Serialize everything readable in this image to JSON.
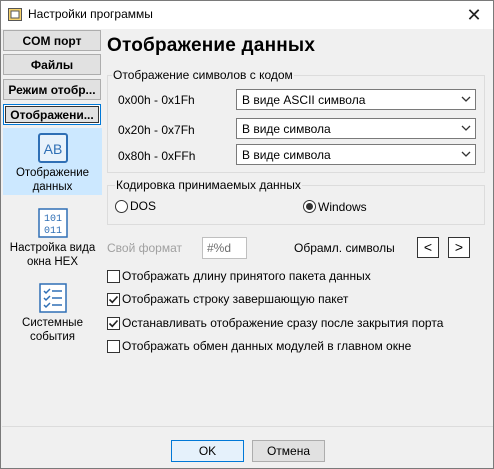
{
  "window": {
    "title": "Настройки программы",
    "close_glyph": "✕"
  },
  "nav": {
    "buttons": [
      {
        "label": "COM порт"
      },
      {
        "label": "Файлы"
      },
      {
        "label": "Режим отобр..."
      },
      {
        "label": "Отображени..."
      }
    ]
  },
  "sidebar": {
    "items": [
      {
        "label_line1": "Отображение",
        "label_line2": "данных",
        "icon": "ab-text-icon"
      },
      {
        "label_line1": "Настройка вида",
        "label_line2": "окна HEX",
        "icon": "binary-icon"
      },
      {
        "label_line1": "Системные",
        "label_line2": "события",
        "icon": "checklist-icon"
      }
    ]
  },
  "main": {
    "heading": "Отображение данных",
    "char_group": {
      "title": "Отображение символов с кодом",
      "rows": [
        {
          "range": "0x00h - 0x1Fh",
          "value": "В виде ASCII символа"
        },
        {
          "range": "0x20h - 0x7Fh",
          "value": "В виде символа"
        },
        {
          "range": "0x80h - 0xFFh",
          "value": "В виде символа"
        }
      ]
    },
    "encoding_group": {
      "title": "Кодировка принимаемых данных",
      "options": [
        {
          "label": "DOS",
          "selected": false
        },
        {
          "label": "Windows",
          "selected": true
        }
      ]
    },
    "custom_format": {
      "label": "Свой формат",
      "value": "#%d"
    },
    "frame_symbols": {
      "label": "Обрамл. символы",
      "left": "<",
      "right": ">"
    },
    "checkboxes": [
      {
        "label": "Отображать длину принятого пакета данных",
        "checked": false
      },
      {
        "label": "Отображать строку завершающую пакет",
        "checked": true
      },
      {
        "label": "Останавливать отображение сразу после закрытия порта",
        "checked": true
      },
      {
        "label": "Отображать обмен данных модулей в главном окне",
        "checked": false
      }
    ]
  },
  "footer": {
    "ok_label": "OK",
    "cancel_label": "Отмена"
  }
}
